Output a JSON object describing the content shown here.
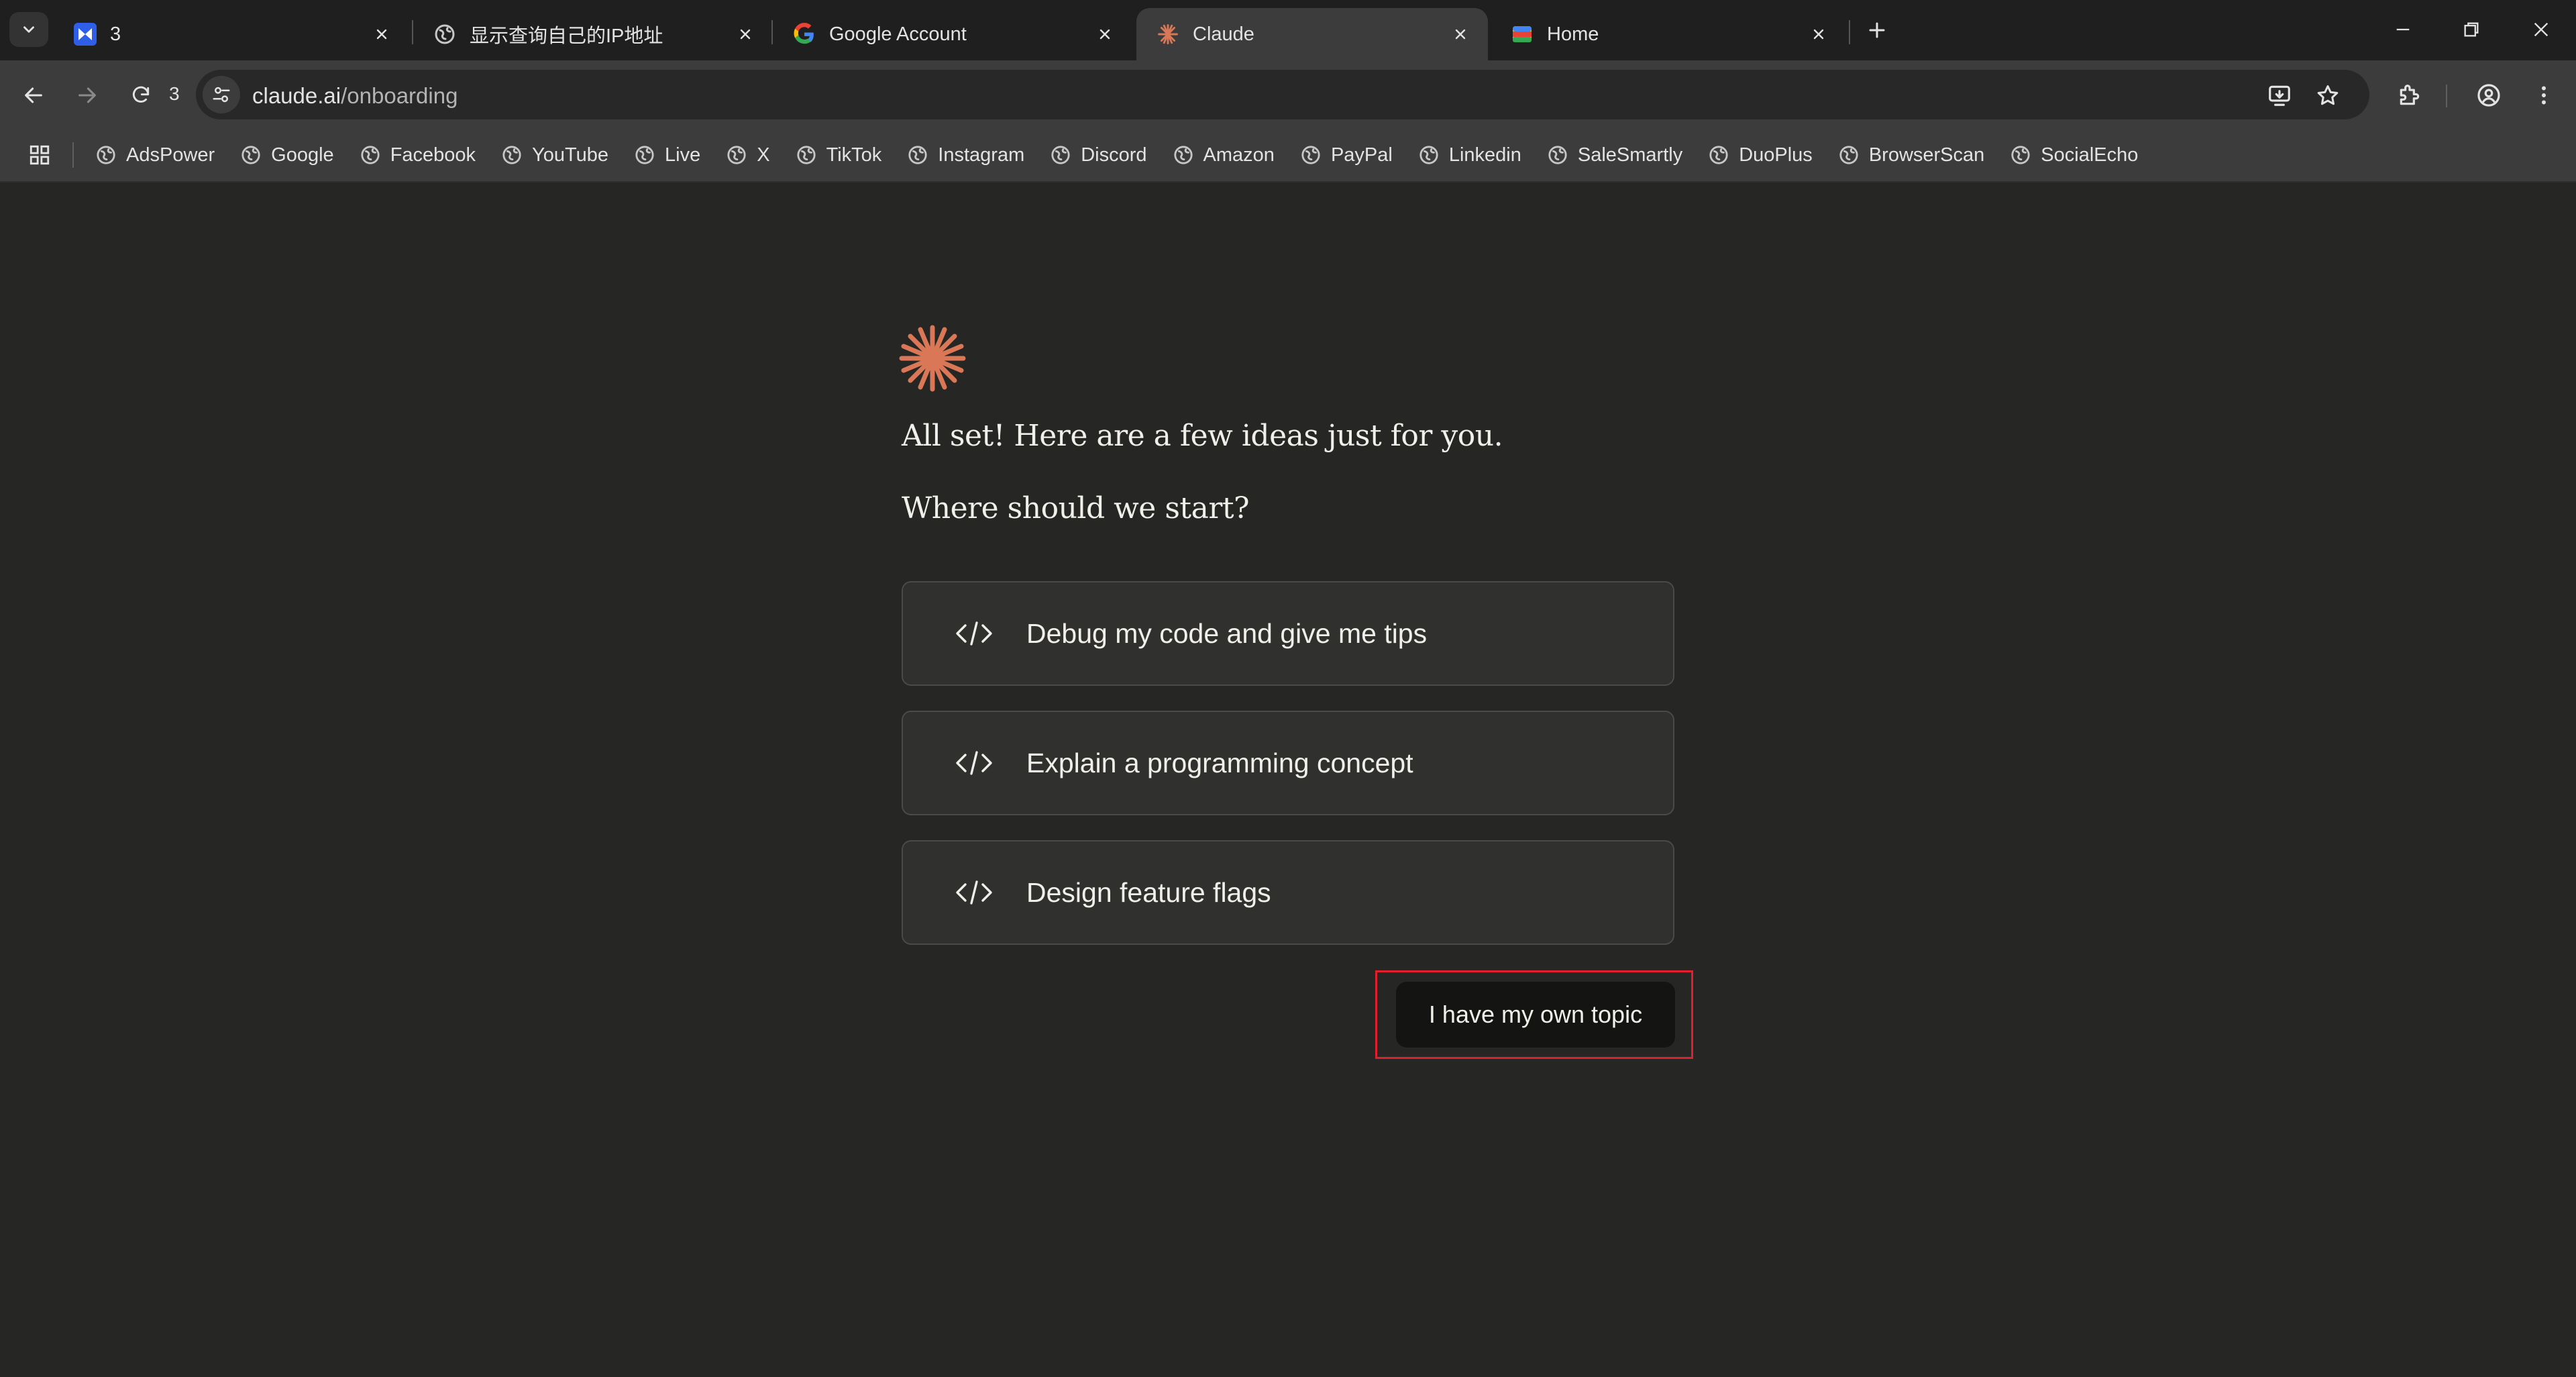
{
  "browser": {
    "tabs": [
      {
        "title": "3",
        "favicon": "adspower-icon"
      },
      {
        "title": "显示查询自己的IP地址",
        "favicon": "globe-icon"
      },
      {
        "title": "Google Account",
        "favicon": "google-icon"
      },
      {
        "title": "Claude",
        "favicon": "claude-spark-icon",
        "active": true
      },
      {
        "title": "Home",
        "favicon": "home-app-icon"
      }
    ],
    "reload_count": "3",
    "url_host": "claude.ai",
    "url_path": "/onboarding",
    "bookmarks": [
      "AdsPower",
      "Google",
      "Facebook",
      "YouTube",
      "Live",
      "X",
      "TikTok",
      "Instagram",
      "Discord",
      "Amazon",
      "PayPal",
      "Linkedin",
      "SaleSmartly",
      "DuoPlus",
      "BrowserScan",
      "SocialEcho"
    ]
  },
  "page": {
    "heading": "All set! Here are a few ideas just for you.",
    "subheading": "Where should we start?",
    "options": [
      {
        "label": "Debug my code and give me tips",
        "icon": "code-icon"
      },
      {
        "label": "Explain a programming concept",
        "icon": "code-icon"
      },
      {
        "label": "Design feature flags",
        "icon": "code-icon"
      }
    ],
    "own_topic_label": "I have my own topic"
  },
  "colors": {
    "accent": "#d97757",
    "background": "#262624",
    "highlight_box": "#e0202e"
  }
}
